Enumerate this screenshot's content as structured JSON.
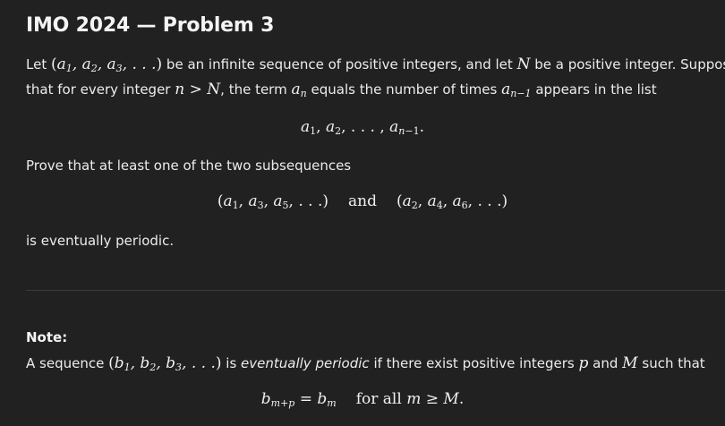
{
  "title": "IMO 2024 — Problem 3",
  "statement": {
    "p1_let": "Let",
    "p1_mid": "be an infinite sequence of positive integers, and let",
    "p1_end": "be a positive integer. Suppose",
    "p2_start": "that for every integer",
    "p2_term": ", the term",
    "p2_equals": "equals the number of times",
    "p2_end": "appears in the list",
    "display_list": "a₁, a₂, . . . , aₙ₋₁.",
    "prove": "Prove that at least one of the two subsequences",
    "display_and": "and",
    "conclusion": "is eventually periodic."
  },
  "note": {
    "label": "Note:",
    "a_sequence": "A sequence",
    "is": "is",
    "term": "eventually periodic",
    "if_exist": "if there exist positive integers",
    "and": "and",
    "such_that": "such that",
    "display_text": "for all"
  }
}
